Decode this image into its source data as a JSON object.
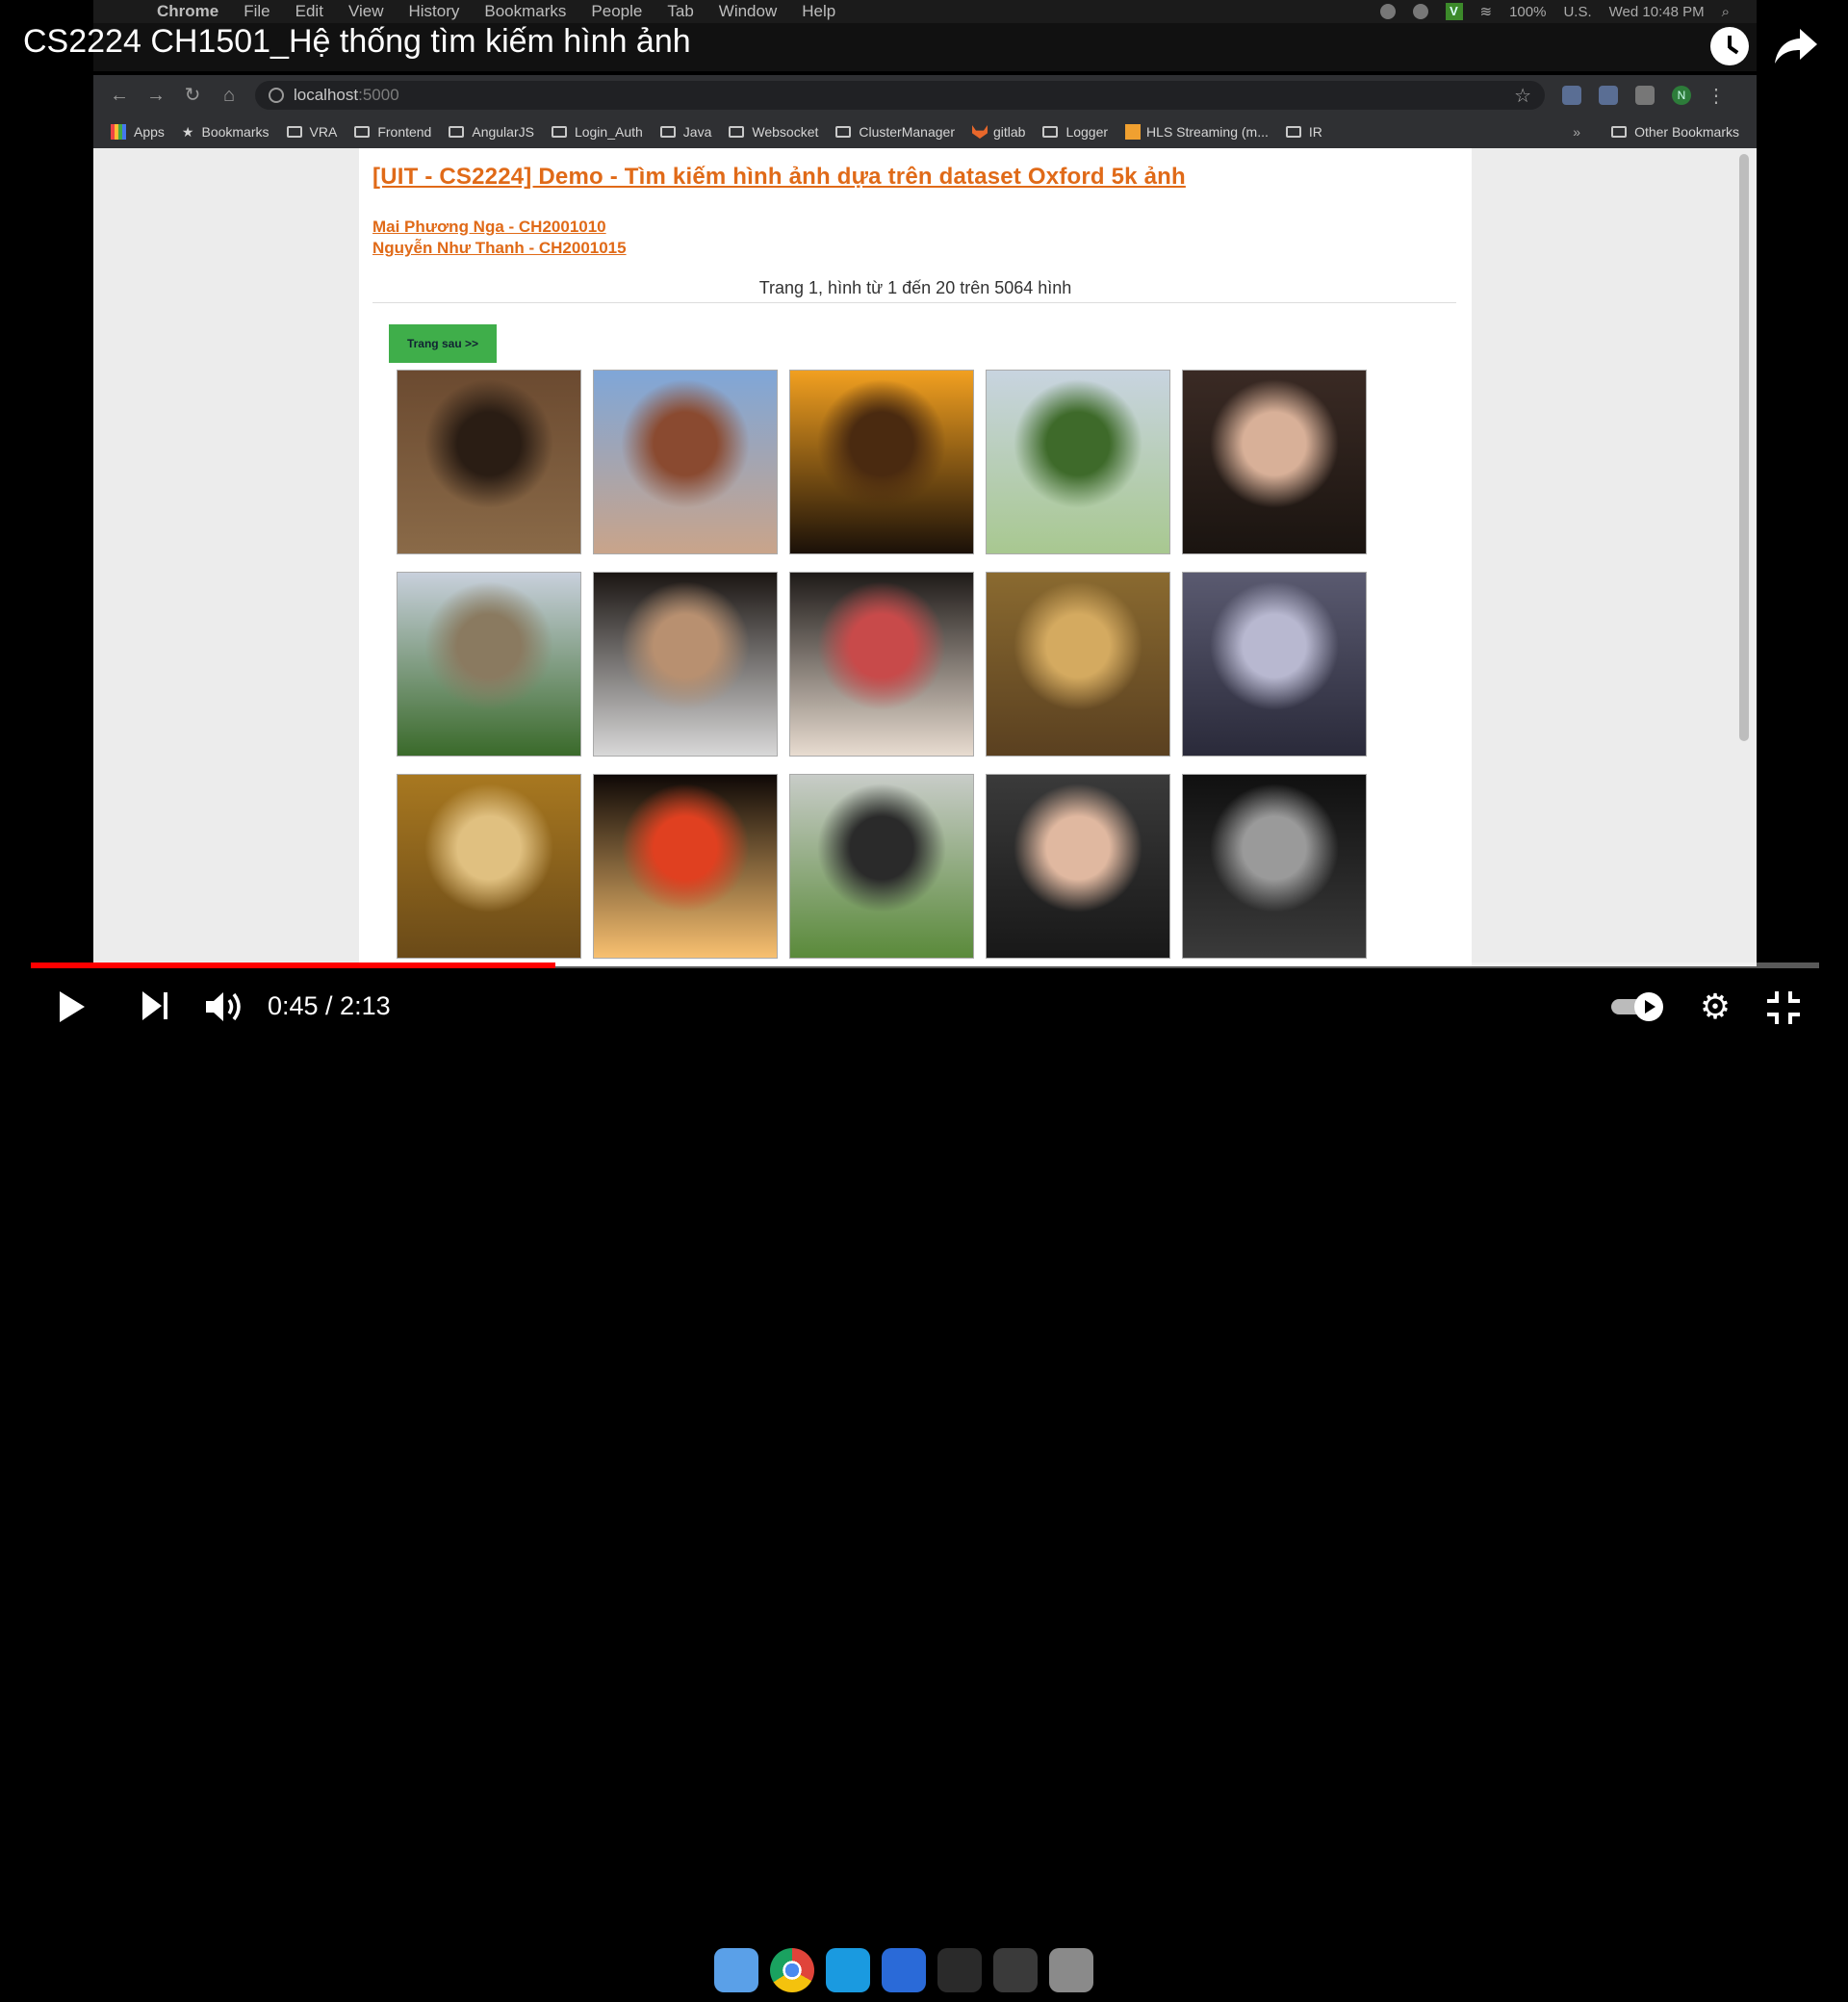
{
  "video": {
    "title": "CS2224 CH1501_Hệ thống tìm kiếm hình ảnh",
    "time_display": "0:45 / 2:13",
    "progress_fraction": 0.2935
  },
  "mac_menubar": {
    "items": [
      "Chrome",
      "File",
      "Edit",
      "View",
      "History",
      "Bookmarks",
      "People",
      "Tab",
      "Window",
      "Help"
    ],
    "status": {
      "battery": "100%",
      "locale": "U.S.",
      "datetime": "Wed 10:48 PM"
    }
  },
  "browser": {
    "url_host": "localhost",
    "url_port": ":5000",
    "bookmarks": [
      "Apps",
      "Bookmarks",
      "VRA",
      "Frontend",
      "AngularJS",
      "Login_Auth",
      "Java",
      "Websocket",
      "ClusterManager",
      "gitlab",
      "Logger",
      "HLS Streaming (m...",
      "IR"
    ],
    "other_bookmarks": "Other Bookmarks",
    "profile_initial": "N"
  },
  "page": {
    "title": "[UIT - CS2224] Demo - Tìm kiếm hình ảnh dựa trên dataset Oxford 5k ảnh",
    "authors": [
      "Mai Phương Nga - CH2001010",
      "Nguyễn Như Thanh - CH2001015"
    ],
    "pager_text": "Trang 1, hình từ 1 đến 20 trên 5064 hình",
    "next_button": "Trang sau >>",
    "images": [
      {
        "subject": "people-in-hall",
        "colors": [
          "#6b4a30",
          "#2a1d14",
          "#8a6a48"
        ]
      },
      {
        "subject": "red-brick-towers",
        "colors": [
          "#7fa6d8",
          "#8a4a30",
          "#c9a48a"
        ]
      },
      {
        "subject": "sunset-over-river",
        "colors": [
          "#f2a020",
          "#4a2a10",
          "#1a1008"
        ]
      },
      {
        "subject": "green-lawn-park",
        "colors": [
          "#c8d4e0",
          "#3e6a2a",
          "#a8c890"
        ]
      },
      {
        "subject": "smiling-couple",
        "colors": [
          "#3a2a24",
          "#d8b098",
          "#1a1410"
        ]
      },
      {
        "subject": "gothic-college",
        "colors": [
          "#c8d0dc",
          "#8a7a60",
          "#3a6a2a"
        ]
      },
      {
        "subject": "young-man-portrait",
        "colors": [
          "#1a1512",
          "#b89070",
          "#d8d8d8"
        ]
      },
      {
        "subject": "party-crowd",
        "colors": [
          "#1e1a18",
          "#c84a4a",
          "#e8dcd0"
        ]
      },
      {
        "subject": "cathedral-window",
        "colors": [
          "#8a6a30",
          "#d4aa60",
          "#5a4020"
        ]
      },
      {
        "subject": "light-letters",
        "colors": [
          "#5a5a70",
          "#b8b8d0",
          "#2a2a3a"
        ]
      },
      {
        "subject": "organ-interior",
        "colors": [
          "#a87820",
          "#e0c080",
          "#6a4a18"
        ]
      },
      {
        "subject": "lanterns-at-night",
        "colors": [
          "#0e0806",
          "#e04020",
          "#f8c070"
        ]
      },
      {
        "subject": "group-on-lawn",
        "colors": [
          "#c8ccc8",
          "#2a2a2a",
          "#5a8a3a"
        ]
      },
      {
        "subject": "couple-with-glasses",
        "colors": [
          "#3a3a3a",
          "#e0b8a0",
          "#181818"
        ]
      },
      {
        "subject": "guitarists-on-stage",
        "colors": [
          "#101010",
          "#9a9a9a",
          "#3a3a3a"
        ]
      }
    ]
  },
  "dock": [
    {
      "name": "finder-icon",
      "color": "#5aa0e8"
    },
    {
      "name": "chrome-icon",
      "color": "#e0e0e0"
    },
    {
      "name": "skype-icon",
      "color": "#1a9ae0"
    },
    {
      "name": "vpn-icon",
      "color": "#2a6ad8"
    },
    {
      "name": "terminal-icon",
      "color": "#2a2a2a"
    },
    {
      "name": "display-icon",
      "color": "#3a3a3a"
    },
    {
      "name": "trash-icon",
      "color": "#8a8a8a"
    }
  ]
}
